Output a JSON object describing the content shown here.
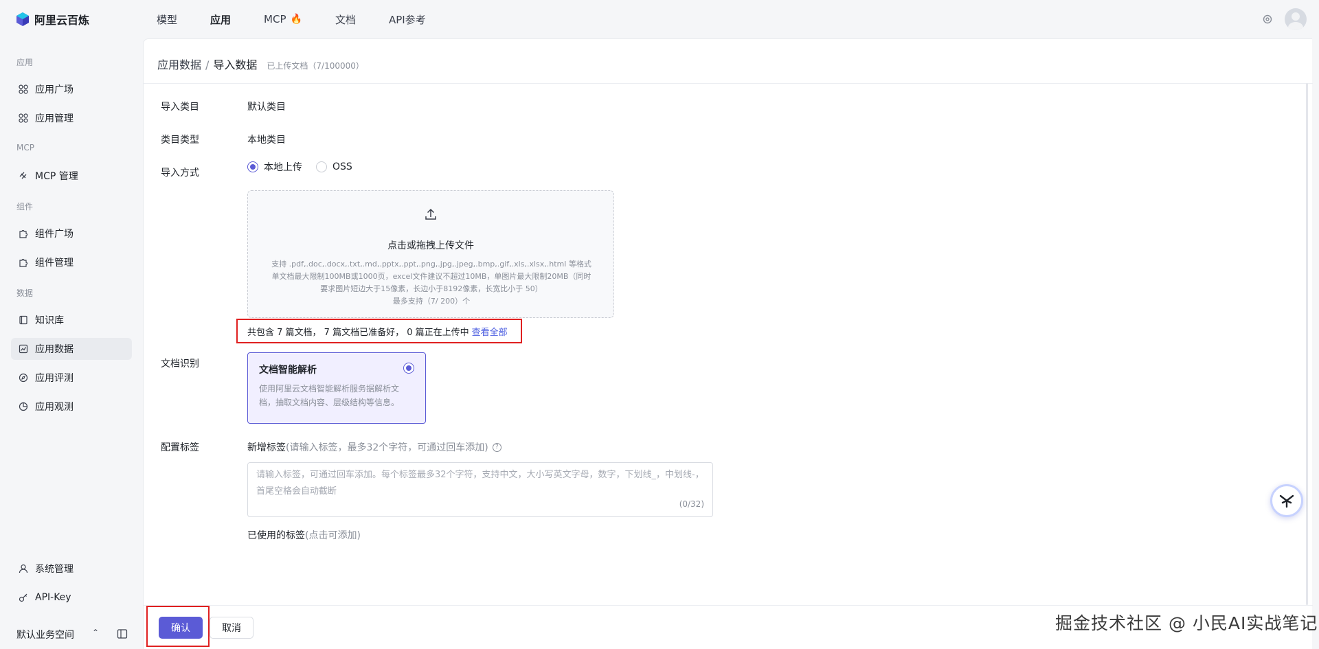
{
  "app": {
    "name": "阿里云百炼"
  },
  "topnav": {
    "items": [
      {
        "label": "模型"
      },
      {
        "label": "应用"
      },
      {
        "label": "MCP"
      },
      {
        "label": "文档"
      },
      {
        "label": "API参考"
      }
    ],
    "fire_icon": "fire-icon"
  },
  "sidebar": {
    "groups": {
      "app": "应用",
      "mcp": "MCP",
      "component": "组件",
      "data": "数据"
    },
    "items": {
      "app_plaza": "应用广场",
      "app_manage": "应用管理",
      "mcp_manage": "MCP 管理",
      "comp_plaza": "组件广场",
      "comp_manage": "组件管理",
      "knowledge": "知识库",
      "app_data": "应用数据",
      "app_eval": "应用评测",
      "app_observe": "应用观测",
      "system": "系统管理",
      "apikey": "API-Key"
    },
    "workspace": "默认业务空间"
  },
  "header": {
    "crumb1": "应用数据",
    "sep": "/",
    "crumb2": "导入数据",
    "sub": "已上传文档（7/100000）"
  },
  "form": {
    "category_label": "导入类目",
    "category_value": "默认类目",
    "type_label": "类目类型",
    "type_value": "本地类目",
    "method_label": "导入方式",
    "method_local": "本地上传",
    "method_oss": "OSS",
    "upload_title": "点击或拖拽上传文件",
    "upload_hint1": "支持 .pdf,.doc,.docx,.txt,.md,.pptx,.ppt,.png,.jpg,.jpeg,.bmp,.gif,.xls,.xlsx,.html 等格式",
    "upload_hint2": "单文档最大限制100MB或1000页，excel文件建议不超过10MB，单图片最大限制20MB（同时",
    "upload_hint3": "要求图片短边大于15像素，长边小于8192像素，长宽比小于 50）",
    "upload_hint4": "最多支持（7/ 200）个",
    "status_text": "共包含 7 篇文档， 7 篇文档已准备好， 0 篇正在上传中",
    "view_all": "查看全部",
    "recog_label": "文档识别",
    "card_title": "文档智能解析",
    "card_desc": "使用阿里云文档智能解析服务据解析文档，抽取文档内容、层级结构等信息。",
    "tag_label": "配置标签",
    "tag_title": "新增标签",
    "tag_title_hint": "(请输入标签，最多32个字符，可通过回车添加)",
    "tag_placeholder": "请输入标签，可通过回车添加。每个标签最多32个字符，支持中文，大小写英文字母，数字，下划线_，中划线-，首尾空格会自动截断",
    "tag_counter": "(0/32)",
    "used_tags": "已使用的标签",
    "used_tags_hint": "(点击可添加)"
  },
  "actions": {
    "confirm": "确认",
    "cancel": "取消"
  },
  "watermark": "掘金技术社区 @ 小民AI实战笔记",
  "colors": {
    "accent": "#5b5bd6",
    "highlight_border": "#e02020",
    "link": "#4c5ee0"
  }
}
